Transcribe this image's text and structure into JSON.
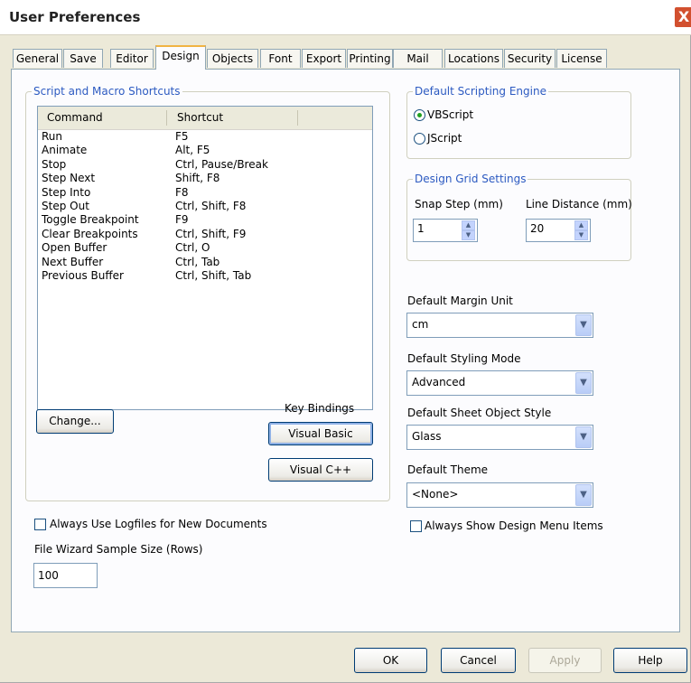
{
  "window": {
    "title": "User Preferences",
    "close_glyph": "X"
  },
  "tabs": [
    "General",
    "Save",
    "Editor",
    "Design",
    "Objects",
    "Font",
    "Export",
    "Printing",
    "Mail",
    "Locations",
    "Security",
    "License"
  ],
  "active_tab": "Design",
  "shortcuts": {
    "group_title": "Script and Macro Shortcuts",
    "columns": [
      "Command",
      "Shortcut"
    ],
    "rows": [
      {
        "command": "Run",
        "shortcut": "F5"
      },
      {
        "command": "Animate",
        "shortcut": "Alt, F5"
      },
      {
        "command": "Stop",
        "shortcut": "Ctrl, Pause/Break"
      },
      {
        "command": "Step Next",
        "shortcut": "Shift, F8"
      },
      {
        "command": "Step Into",
        "shortcut": "F8"
      },
      {
        "command": "Step Out",
        "shortcut": "Ctrl, Shift, F8"
      },
      {
        "command": "Toggle Breakpoint",
        "shortcut": "F9"
      },
      {
        "command": "Clear Breakpoints",
        "shortcut": "Ctrl, Shift, F9"
      },
      {
        "command": "Open Buffer",
        "shortcut": "Ctrl, O"
      },
      {
        "command": "Next Buffer",
        "shortcut": "Ctrl, Tab"
      },
      {
        "command": "Previous Buffer",
        "shortcut": "Ctrl, Shift, Tab"
      }
    ],
    "change_button": "Change...",
    "key_bindings_label": "Key Bindings",
    "visual_basic_button": "Visual Basic",
    "visual_cpp_button": "Visual C++"
  },
  "scripting_engine": {
    "group_title": "Default Scripting Engine",
    "options": [
      "VBScript",
      "JScript"
    ],
    "selected": "VBScript"
  },
  "grid": {
    "group_title": "Design Grid Settings",
    "snap_step_label": "Snap Step (mm)",
    "snap_step_value": "1",
    "line_distance_label": "Line Distance (mm)",
    "line_distance_value": "20"
  },
  "defaults": {
    "margin_unit_label": "Default Margin Unit",
    "margin_unit_value": "cm",
    "styling_mode_label": "Default Styling Mode",
    "styling_mode_value": "Advanced",
    "sheet_object_style_label": "Default Sheet Object Style",
    "sheet_object_style_value": "Glass",
    "theme_label": "Default Theme",
    "theme_value": "<None>"
  },
  "checkboxes": {
    "logfiles_label": "Always Use Logfiles for New Documents",
    "logfiles_checked": false,
    "design_menu_label": "Always Show Design Menu Items",
    "design_menu_checked": false
  },
  "wizard": {
    "label": "File Wizard Sample Size (Rows)",
    "value": "100"
  },
  "footer": {
    "ok": "OK",
    "cancel": "Cancel",
    "apply": "Apply",
    "help": "Help"
  },
  "icons": {
    "spin_up": "spin-up-icon",
    "spin_down": "spin-down-icon",
    "dropdown": "chevron-down-icon"
  },
  "colors": {
    "group_title": "#2c5ac1",
    "active_tab_accent": "#f1b443",
    "close_button": "#d2502f",
    "radio_selected": "#21a121"
  }
}
